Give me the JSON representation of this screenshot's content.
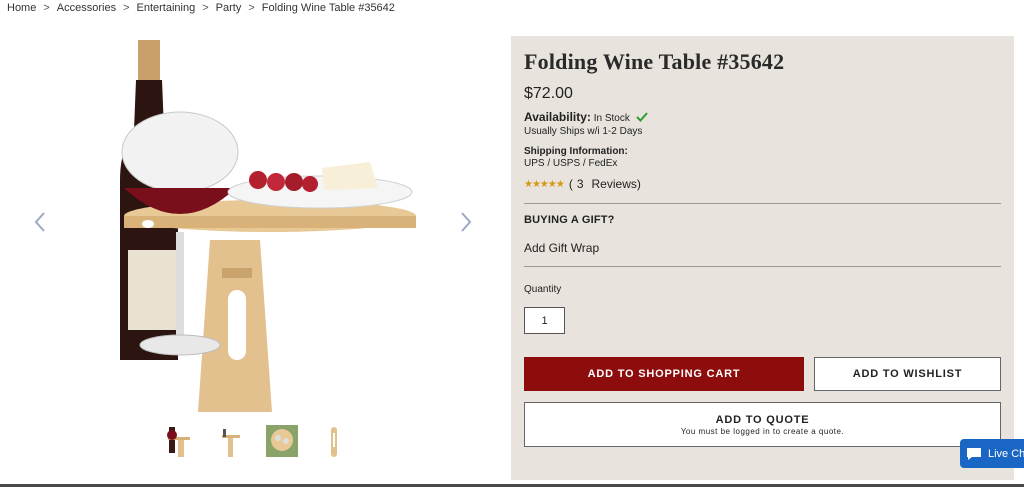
{
  "breadcrumb": {
    "items": [
      "Home",
      "Accessories",
      "Entertaining",
      "Party",
      "Folding Wine Table #35642"
    ],
    "separator": ">"
  },
  "gallery": {
    "prev_icon": "chevron-left-icon",
    "next_icon": "chevron-right-icon",
    "thumbnail_count": 4
  },
  "product": {
    "title": "Folding Wine Table #35642",
    "price": "$72.00",
    "availability_label": "Availability:",
    "availability_value": "In Stock",
    "ships": "Usually Ships w/i 1-2 Days",
    "shipping_label": "Shipping Information:",
    "shipping_value": "UPS / USPS / FedEx",
    "stars": "★★★★★",
    "rating_value": 5,
    "rating_max": 5,
    "review_count": "3",
    "reviews_label": "Reviews)",
    "review_open": "("
  },
  "gift": {
    "heading": "BUYING A GIFT?",
    "wrap_label": "Add Gift Wrap"
  },
  "quantity": {
    "label": "Quantity",
    "value": "1"
  },
  "actions": {
    "cart": "ADD TO SHOPPING CART",
    "wishlist": "ADD TO WISHLIST",
    "quote": "ADD TO QUOTE",
    "quote_note": "You must be logged in to create a quote."
  },
  "chat": {
    "label": "Live Ch"
  },
  "colors": {
    "panel_bg": "#e8e4dd",
    "cart_button": "#8d0c0c",
    "star": "#d69a12",
    "check": "#2e9e2e",
    "chat": "#1a66c5"
  }
}
